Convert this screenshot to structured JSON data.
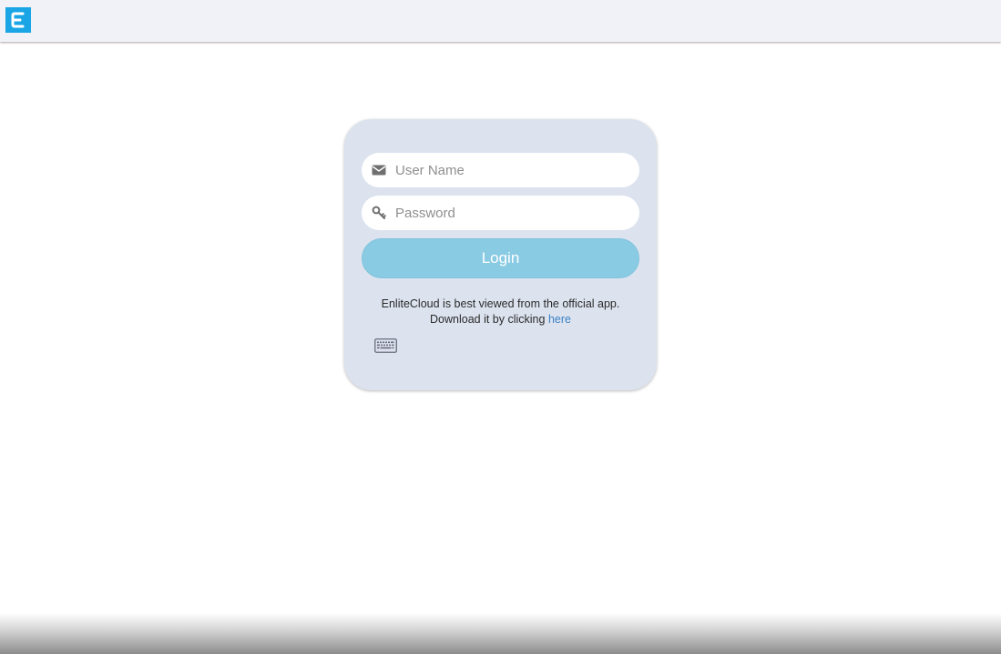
{
  "header": {
    "logo_letter": "E",
    "logo_color": "#1aa6e6"
  },
  "login": {
    "username_placeholder": "User Name",
    "username_icon": "envelope-icon",
    "password_placeholder": "Password",
    "password_icon": "key-icon",
    "login_label": "Login",
    "notice_line1": "EnliteCloud is best viewed from the official app.",
    "notice_line2_prefix": "Download it by clicking ",
    "notice_link": "here",
    "keyboard_icon": "keyboard-icon"
  },
  "colors": {
    "card_bg": "#dce3ef",
    "button_bg": "#8acbe4",
    "link": "#3d82c4"
  }
}
